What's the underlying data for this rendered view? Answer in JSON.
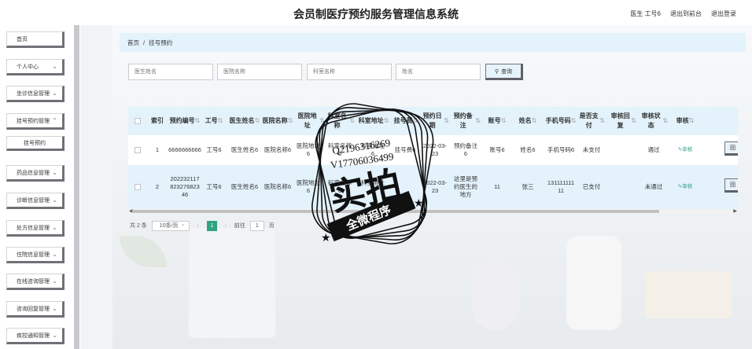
{
  "header": {
    "title": "会员制医疗预约服务管理信息系统",
    "user": "医生 工号6",
    "back_front": "退出到前台",
    "logout": "退出登录"
  },
  "sidebar": {
    "items": [
      {
        "label": "首页"
      },
      {
        "label": "个人中心"
      },
      {
        "label": "坐诊信息管理"
      },
      {
        "label": "挂号预约管理"
      },
      {
        "label": "挂号预约"
      },
      {
        "label": "药品信息管理"
      },
      {
        "label": "诊断信息管理"
      },
      {
        "label": "处方信息管理"
      },
      {
        "label": "住院信息管理"
      },
      {
        "label": "在线咨询管理"
      },
      {
        "label": "咨询回复管理"
      },
      {
        "label": "疾控通知管理"
      }
    ]
  },
  "breadcrumb": {
    "home": "首页",
    "sep": "/",
    "current": "挂号预约"
  },
  "search": {
    "doctor_placeholder": "医生姓名",
    "hospital_placeholder": "医院名称",
    "dept_placeholder": "科室名称",
    "name_placeholder": "姓名",
    "button": "查询"
  },
  "table": {
    "headers": [
      "索引",
      "预约编号",
      "工号",
      "医生姓名",
      "医院名称",
      "医院地址",
      "科室名称",
      "科室地址",
      "挂号费",
      "预约日期",
      "预约备注",
      "账号",
      "姓名",
      "手机号码",
      "是否支付",
      "审核回复",
      "审核状态",
      "审核"
    ],
    "rows": [
      {
        "index": "1",
        "appt_no": "6666666666",
        "job_no": "工号6",
        "doctor": "医生姓名6",
        "hospital": "医院名称6",
        "hosp_addr": "医院地址6",
        "dept": "科室名称6",
        "dept_addr": "科室地址6",
        "fee": "挂号费6",
        "date": "2022-03-23",
        "remark": "预约备注6",
        "account": "账号6",
        "name": "姓名6",
        "phone": "手机号码6",
        "paid": "未支付",
        "reply": "",
        "status": "通过",
        "audit": "审核",
        "edge": "回"
      },
      {
        "index": "2",
        "appt_no": "20223211782327682346",
        "job_no": "工号6",
        "doctor": "医生姓名6",
        "hospital": "医院名称6",
        "hosp_addr": "医院地址6",
        "dept": "科室名称6",
        "dept_addr": "科室地址6",
        "fee": "",
        "date": "2022-03-23",
        "remark": "这里是预约医生的地方",
        "account": "11",
        "name": "张三",
        "phone": "13111111111",
        "paid": "已支付",
        "reply": "",
        "status": "未通过",
        "audit": "审核",
        "edge": "回"
      }
    ]
  },
  "pagination": {
    "total": "共 2 条",
    "page_size": "10条/页",
    "prev": "‹",
    "page": "1",
    "next": "›",
    "goto": "前往",
    "goto_page": "1",
    "page_unit": "页"
  },
  "watermark": {
    "qq": "Q2196316269",
    "vx": "V17706036499",
    "big": "实拍",
    "banner": "全微程序"
  }
}
